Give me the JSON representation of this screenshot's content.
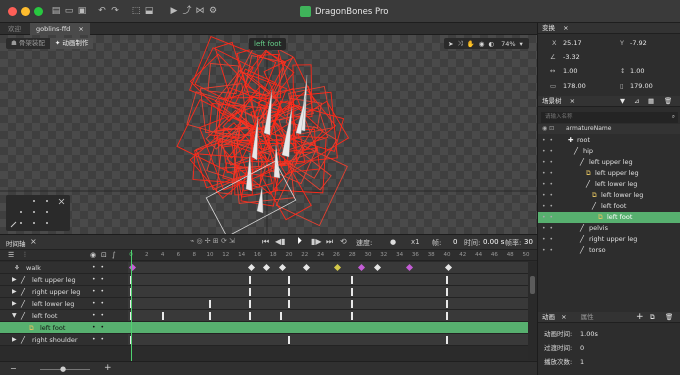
{
  "titlebar": {
    "title": "DragonBones Pro",
    "traffic_colors": [
      "#fe5f57",
      "#febc2e",
      "#28c840"
    ]
  },
  "tabs": [
    {
      "label": "欢迎"
    },
    {
      "label": "goblins-ffd"
    }
  ],
  "viewport": {
    "mode_armature": "骨架装配",
    "mode_animate": "动画制作",
    "selected_label": "left foot",
    "zoom": "74%"
  },
  "timeline": {
    "panel_title": "时间轴",
    "speed_label": "速度:",
    "speed_value": "x1",
    "frame_label": "帧:",
    "frame_value": "0",
    "time_label": "时间:",
    "time_value": "0.00 s",
    "fps_label": "帧率:",
    "fps_value": "30",
    "ruler": [
      "0",
      "2",
      "4",
      "6",
      "8",
      "10",
      "12",
      "14",
      "16",
      "18",
      "20",
      "22",
      "24",
      "26",
      "28",
      "30",
      "32",
      "34",
      "36",
      "38",
      "40",
      "42",
      "44",
      "46",
      "48",
      "50"
    ],
    "tracks": [
      {
        "name": "walk",
        "indent": 0,
        "type": "anim"
      },
      {
        "name": "left upper leg",
        "indent": 1,
        "type": "bone"
      },
      {
        "name": "right upper leg",
        "indent": 1,
        "type": "bone"
      },
      {
        "name": "left lower leg",
        "indent": 1,
        "type": "bone"
      },
      {
        "name": "left foot",
        "indent": 1,
        "type": "bone",
        "expanded": true
      },
      {
        "name": "left foot",
        "indent": 2,
        "type": "slot",
        "selected": true
      },
      {
        "name": "right shoulder",
        "indent": 1,
        "type": "bone"
      }
    ],
    "keyframes": {
      "walk": [
        0,
        15,
        17,
        19,
        22,
        26,
        29,
        31,
        35,
        40
      ],
      "left upper leg": [
        0,
        15,
        20,
        28,
        40
      ],
      "right upper leg": [
        0,
        15,
        20,
        28,
        40
      ],
      "left lower leg": [
        0,
        10,
        15,
        20,
        28,
        40
      ],
      "left foot": [
        0,
        4,
        10,
        15,
        19,
        28,
        40
      ],
      "left foot slot": [],
      "right shoulder": [
        0,
        20,
        40
      ]
    },
    "walk_key_colors": {
      "26": "#d4c94a",
      "29": "#c45dd6",
      "35": "#c45dd6"
    }
  },
  "transform": {
    "title": "变换",
    "x_label": "X",
    "x_value": "25.17",
    "y_label": "Y",
    "y_value": "-7.92",
    "rot_value": "-3.32",
    "scale_x": "1.00",
    "scale_y": "1.00",
    "w_value": "178.00",
    "h_value": "179.00"
  },
  "scene": {
    "title": "场景树",
    "search_placeholder": "请输入名称",
    "armature": "armatureName",
    "nodes": [
      {
        "label": "root",
        "depth": 0,
        "icon": "root"
      },
      {
        "label": "hip",
        "depth": 1,
        "icon": "bone"
      },
      {
        "label": "left upper leg",
        "depth": 2,
        "icon": "bone"
      },
      {
        "label": "left upper leg",
        "depth": 3,
        "icon": "slot"
      },
      {
        "label": "left lower leg",
        "depth": 3,
        "icon": "bone"
      },
      {
        "label": "left lower leg",
        "depth": 4,
        "icon": "slot"
      },
      {
        "label": "left foot",
        "depth": 4,
        "icon": "bone"
      },
      {
        "label": "left foot",
        "depth": 5,
        "icon": "slot",
        "selected": true
      },
      {
        "label": "pelvis",
        "depth": 2,
        "icon": "bone"
      },
      {
        "label": "right upper leg",
        "depth": 2,
        "icon": "bone"
      },
      {
        "label": "torso",
        "depth": 2,
        "icon": "bone"
      }
    ]
  },
  "animation": {
    "tab_animation": "动画",
    "tab_property": "属性",
    "duration_label": "动画时间:",
    "duration_value": "1.00s",
    "blend_label": "过渡时间:",
    "blend_value": "0",
    "play_label": "播放次数:",
    "play_value": "1"
  }
}
